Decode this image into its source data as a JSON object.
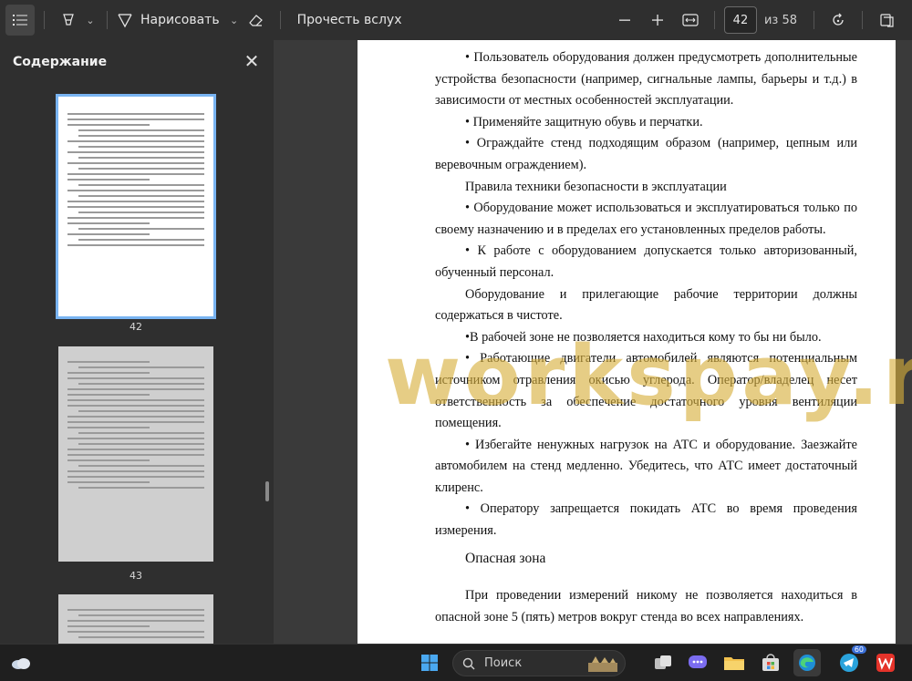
{
  "toolbar": {
    "draw_label": "Нарисовать",
    "read_aloud_label": "Прочесть вслух",
    "page_current": "42",
    "page_total_label": "из 58"
  },
  "sidebar": {
    "title": "Содержание",
    "thumbnails": [
      {
        "page": "42",
        "active": true
      },
      {
        "page": "43",
        "active": false
      }
    ]
  },
  "document": {
    "paragraphs": [
      {
        "style": "ind last",
        "text": "• Пользователь оборудования должен предусмотреть дополнительные устройства безопасности (например, сигнальные лампы, барьеры и т.д.) в"
      },
      {
        "style": "",
        "text": "зависимости от местных особенностей эксплуатации."
      },
      {
        "style": "ind",
        "text": "• Применяйте защитную обувь и перчатки."
      },
      {
        "style": "ind",
        "text": "• Ограждайте стенд подходящим образом (например, цепным или веревочным ограждением)."
      },
      {
        "style": "ind",
        "text": "Правила техники безопасности в эксплуатации"
      },
      {
        "style": "ind",
        "text": "• Оборудование может использоваться и эксплуатироваться только по своему назначению и в пределах его установленных пределов работы."
      },
      {
        "style": "ind",
        "text": "• К работе с оборудованием допускается только авторизованный, обученный персонал."
      },
      {
        "style": "ind",
        "text": "Оборудование и прилегающие рабочие территории должны содержаться в чистоте."
      },
      {
        "style": "ind",
        "text": "•В рабочей зоне не позволяется находиться кому то бы ни было."
      },
      {
        "style": "ind",
        "text": "• Работающие двигатели автомобилей являются потенциальным источником отравления окисью углерода. Оператор/владелец несет ответственность за обеспечение достаточного уровня вентиляции помещения."
      },
      {
        "style": "ind",
        "text": "• Избегайте ненужных нагрузок на АТС и оборудование. Заезжайте автомобилем на стенд медленно. Убедитесь, что АТС имеет достаточный клиренс."
      },
      {
        "style": "ind",
        "text": "• Оператору запрещается покидать АТС во время проведения измерения."
      },
      {
        "style": "heading",
        "text": "Опасная зона"
      },
      {
        "style": "ind gap",
        "text": "При проведении измерений никому не позволяется находиться в опасной зоне 5 (пять) метров вокруг стенда во всех направлениях."
      }
    ]
  },
  "watermark": "workspay.ru",
  "taskbar": {
    "search_label": "Поиск",
    "telegram_badge": "60"
  },
  "colors": {
    "accent": "#79b4f2",
    "watermark": "#d6ae3a"
  }
}
